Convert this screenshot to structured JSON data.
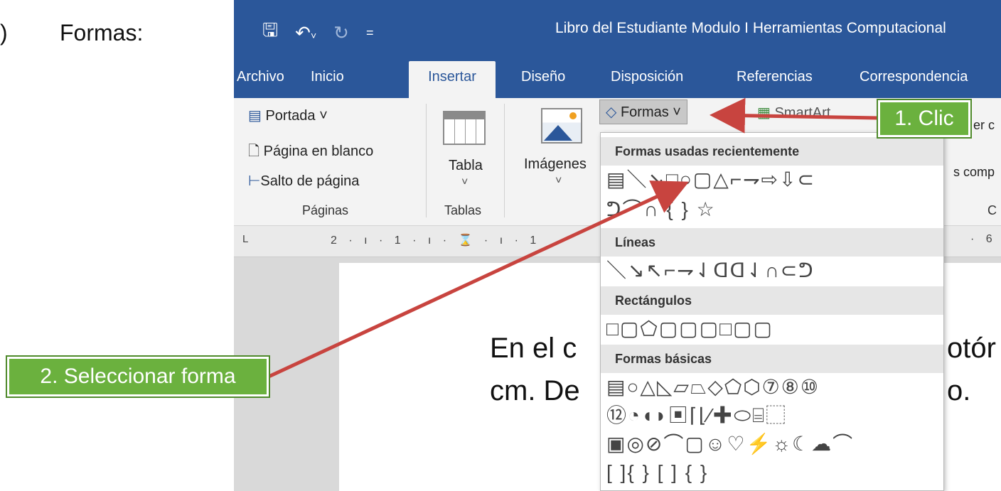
{
  "doc_label": {
    "paren": ")",
    "text": "Formas:"
  },
  "window": {
    "title": "Libro del Estudiante Modulo I Herramientas Computacional",
    "qat": {
      "save": "🖫",
      "undo": "↶",
      "undo_arrow": "˅",
      "redo": "↻",
      "customize": "="
    }
  },
  "tabs": [
    {
      "label": "Archivo"
    },
    {
      "label": "Inicio"
    },
    {
      "label": "Insertar"
    },
    {
      "label": "Diseño"
    },
    {
      "label": "Disposición"
    },
    {
      "label": "Referencias"
    },
    {
      "label": "Correspondencia"
    }
  ],
  "ribbon": {
    "portada": "Portada ˅",
    "pagina_blanco": "Página en blanco",
    "salto_pagina": "Salto de página",
    "group_paginas": "Páginas",
    "tabla": "Tabla",
    "tabla_arrow": "˅",
    "group_tablas": "Tablas",
    "imagenes": "Imágenes",
    "imagenes_arrow": "˅",
    "formas": "Formas ˅",
    "smartart": "SmartArt",
    "cut_right_1": "er c",
    "cut_right_2": "s comp",
    "cut_right_3": "C"
  },
  "ruler": {
    "corner": "L",
    "numbers": "2 · ı · 1 · ı · ⌛ · ı · 1",
    "right_num": "· 6"
  },
  "page_text": {
    "line1_left": "En el c",
    "line1_right": "otór",
    "line2_left": "cm. De",
    "line2_right": "o."
  },
  "dropdown": {
    "section_recent": "Formas usadas recientemente",
    "recent_row1": "▤＼↘□○▢△⌐⇁⇨⇩⊂",
    "recent_row2": "ᕤ⌒∩ { } ☆",
    "section_lines": "Líneas",
    "lines_row": "＼↘↖⌐⇁⇃ꓷꓷ⇃∩⊂ᕤ",
    "section_rects": "Rectángulos",
    "rects_row": "□▢⬠▢▢▢□▢▢",
    "section_basic": "Formas básicas",
    "basic_row1": "▤○△◺▱⏢◇⬠⬡⑦⑧⑩",
    "basic_row2": "⑫◔◖◗▣⌈⌊⁄✚⬭⌸⬚",
    "basic_row3": "▣◎⊘⌒▢☺♡⚡☼☾☁⌒",
    "basic_row4": "[ ]{ } [ ] { }"
  },
  "callouts": {
    "step1": "1. Clic",
    "step2": "2. Seleccionar forma"
  },
  "colors": {
    "title_bar": "#2b579a",
    "callout": "#6bb13e",
    "arrow": "#c8443f"
  }
}
